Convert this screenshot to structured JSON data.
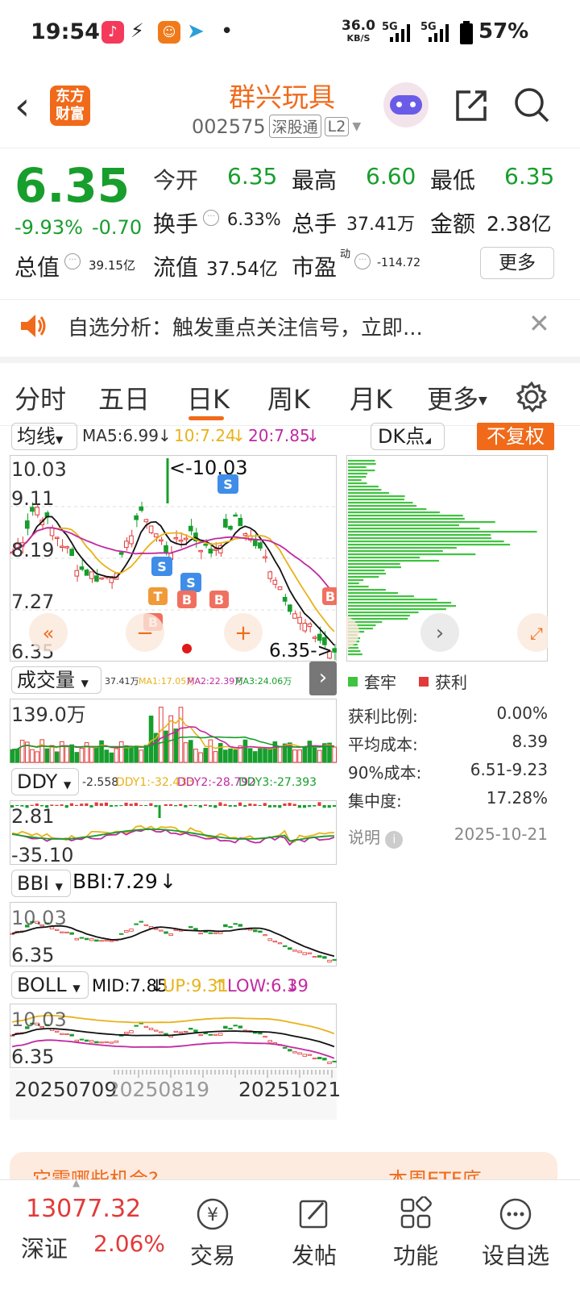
{
  "status": {
    "time": "19:54",
    "net_speed": "36.0",
    "net_unit": "KB/S",
    "net1": "5G",
    "net2": "5G",
    "battery": "57%"
  },
  "header": {
    "logo": "东方\n财富",
    "logo_l1": "东方",
    "logo_l2": "财富",
    "title": "群兴玩具",
    "code": "002575",
    "tag1": "深股通",
    "tag2": "L2"
  },
  "quote": {
    "price": "6.35",
    "pct": "-9.93%",
    "chg": "-0.70",
    "open_label": "今开",
    "open": "6.35",
    "high_label": "最高",
    "high": "6.60",
    "low_label": "最低",
    "low": "6.35",
    "turnover_label": "换手",
    "turnover": "6.33%",
    "volume_label": "总手",
    "volume": "37.41万",
    "amount_label": "金额",
    "amount": "2.38亿",
    "mcap_label": "总值",
    "mcap": "39.15亿",
    "float_label": "流值",
    "float": "37.54亿",
    "pe_label": "市盈",
    "pe_sup": "动",
    "pe": "-114.72",
    "more": "更多"
  },
  "notice": {
    "text": "自选分析：触发重点关注信号，立即..."
  },
  "tabs": [
    "分时",
    "五日",
    "日K",
    "周K",
    "月K",
    "更多"
  ],
  "ma": {
    "sel": "均线",
    "ma5": "MA5:6.99",
    "ma10": "10:7.24",
    "ma20": "20:7.85",
    "dk": "DK点",
    "fq": "不复权"
  },
  "kline": {
    "ticks": [
      "10.03",
      "9.11",
      "8.19",
      "7.27",
      "6.35"
    ],
    "max_label": "<-10.03",
    "min_label": "6.35->"
  },
  "vol": {
    "sel": "成交量",
    "v": "37.41万",
    "ma1": "MA1:17.05万",
    "ma2": "MA2:22.39万",
    "ma3": "MA3:24.06万",
    "top": "139.0万"
  },
  "ddy": {
    "sel": "DDY",
    "v": "-2.558",
    "d1": "DDY1:-32.433",
    "d2": "DDY2:-28.792",
    "d3": "DDY3:-27.393",
    "top": "2.81",
    "bot": "-35.10"
  },
  "bbi": {
    "sel": "BBI",
    "v": "BBI:7.29",
    "top": "10.03",
    "bot": "6.35"
  },
  "boll": {
    "sel": "BOLL",
    "mid": "MID:7.85",
    "up": "UP:9.31",
    "low": "LOW:6.39",
    "top": "10.03",
    "bot": "6.35"
  },
  "dates": [
    "20250709",
    "20250819",
    "20251021"
  ],
  "chip": {
    "legend1": "套牢",
    "legend2": "获利",
    "rows": [
      {
        "k": "获利比例:",
        "v": "0.00%"
      },
      {
        "k": "平均成本:",
        "v": "8.39"
      },
      {
        "k": "90%成本:",
        "v": "6.51-9.23"
      },
      {
        "k": "集中度:",
        "v": "17.28%"
      }
    ],
    "note": "说明",
    "date": "2025-10-21"
  },
  "banner": {
    "left": "它需哪些机会?",
    "right": "本周ETF底"
  },
  "bottom": {
    "index": "13077.32",
    "index_name": "深证",
    "index_pct": "2.06%",
    "items": [
      "交易",
      "发帖",
      "功能",
      "设自选"
    ]
  },
  "colors": {
    "green": "#179e2c",
    "red": "#e23a3a",
    "orange": "#f06a1a"
  }
}
